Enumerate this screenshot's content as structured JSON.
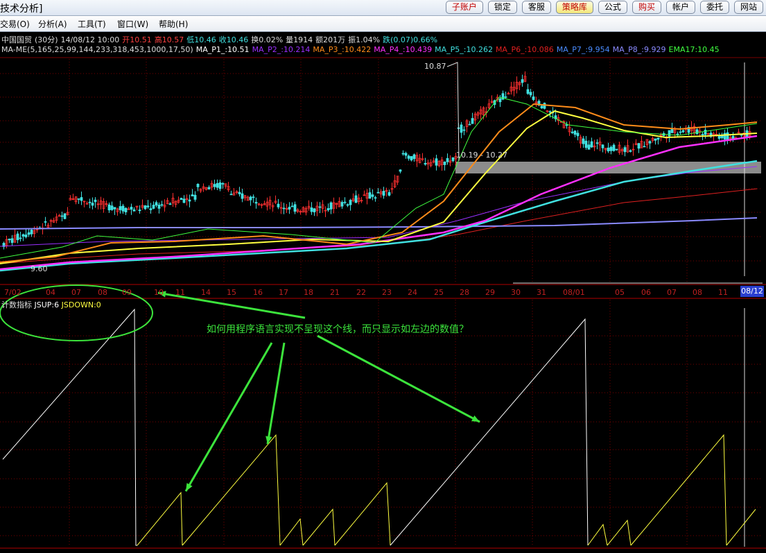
{
  "window": {
    "title": "技术分析]"
  },
  "toolbar": {
    "buttons": [
      {
        "label": "子账户",
        "style": "red"
      },
      {
        "label": "锁定",
        "style": "plain"
      },
      {
        "label": "客服",
        "style": "plain"
      },
      {
        "label": "策略库",
        "style": "hl"
      },
      {
        "label": "公式",
        "style": "plain"
      },
      {
        "label": "购买",
        "style": "red"
      },
      {
        "label": "帐户",
        "style": "plain"
      },
      {
        "label": "委托",
        "style": "plain"
      },
      {
        "label": "网站",
        "style": "plain"
      }
    ]
  },
  "menu": {
    "items": [
      "交易(O)",
      "分析(A)",
      "工具(T)",
      "窗口(W)",
      "帮助(H)"
    ]
  },
  "quote": {
    "name": "中国国贸",
    "period": "(30分)",
    "datetime": "14/08/12 10:00",
    "open": "开10.51",
    "high": "高10.57",
    "low": "低10.46",
    "close": "收10.46",
    "turnover": "换0.02%",
    "volume": "量1914",
    "amount": "额201万",
    "amplitude": "振1.04%",
    "change": "跌(0.07)0.66%"
  },
  "ma_line": {
    "name": "MA-ME(5,165,25,99,144,233,318,453,1000,17,50)",
    "items": [
      {
        "label": "MA_P1_:10.51",
        "color": "#ffffff"
      },
      {
        "label": "MA_P2_:10.214",
        "color": "#9b30ff"
      },
      {
        "label": "MA_P3_:10.422",
        "color": "#ff8c1a"
      },
      {
        "label": "MA_P4_:10.439",
        "color": "#ff30ff"
      },
      {
        "label": "MA_P5_:10.262",
        "color": "#40e0e0"
      },
      {
        "label": "MA_P6_:10.086",
        "color": "#e02020"
      },
      {
        "label": "MA_P7_:9.954",
        "color": "#4a8cff"
      },
      {
        "label": "MA_P8_:9.929",
        "color": "#8a8aff"
      },
      {
        "label": "EMA17:10.45",
        "color": "#40ff40"
      }
    ]
  },
  "price_labels": {
    "max": "10.87",
    "min": "9.60",
    "range": "10.19 - 10.27"
  },
  "dates": [
    "7/02",
    "04",
    "07",
    "08",
    "09",
    "10",
    "11",
    "14",
    "15",
    "16",
    "17",
    "18",
    "21",
    "22",
    "23",
    "24",
    "25",
    "28",
    "29",
    "30",
    "31",
    "08/01",
    "05",
    "06",
    "07",
    "08",
    "11"
  ],
  "selected_date": "08/12",
  "indicator": {
    "name": "计数指标",
    "jsup": "JSUP:6",
    "jsdown": "JSDOWN:0"
  },
  "annotation": {
    "question": "如何用程序语言实现不呈现这个线，而只显示如左边的数值？"
  },
  "colors": {
    "up": "#ff3030",
    "down": "#40e0e0",
    "jsup": "#ffffff",
    "jsdown": "#ffff40",
    "annotation": "#3ce43c",
    "grid": "#7a0000"
  }
}
